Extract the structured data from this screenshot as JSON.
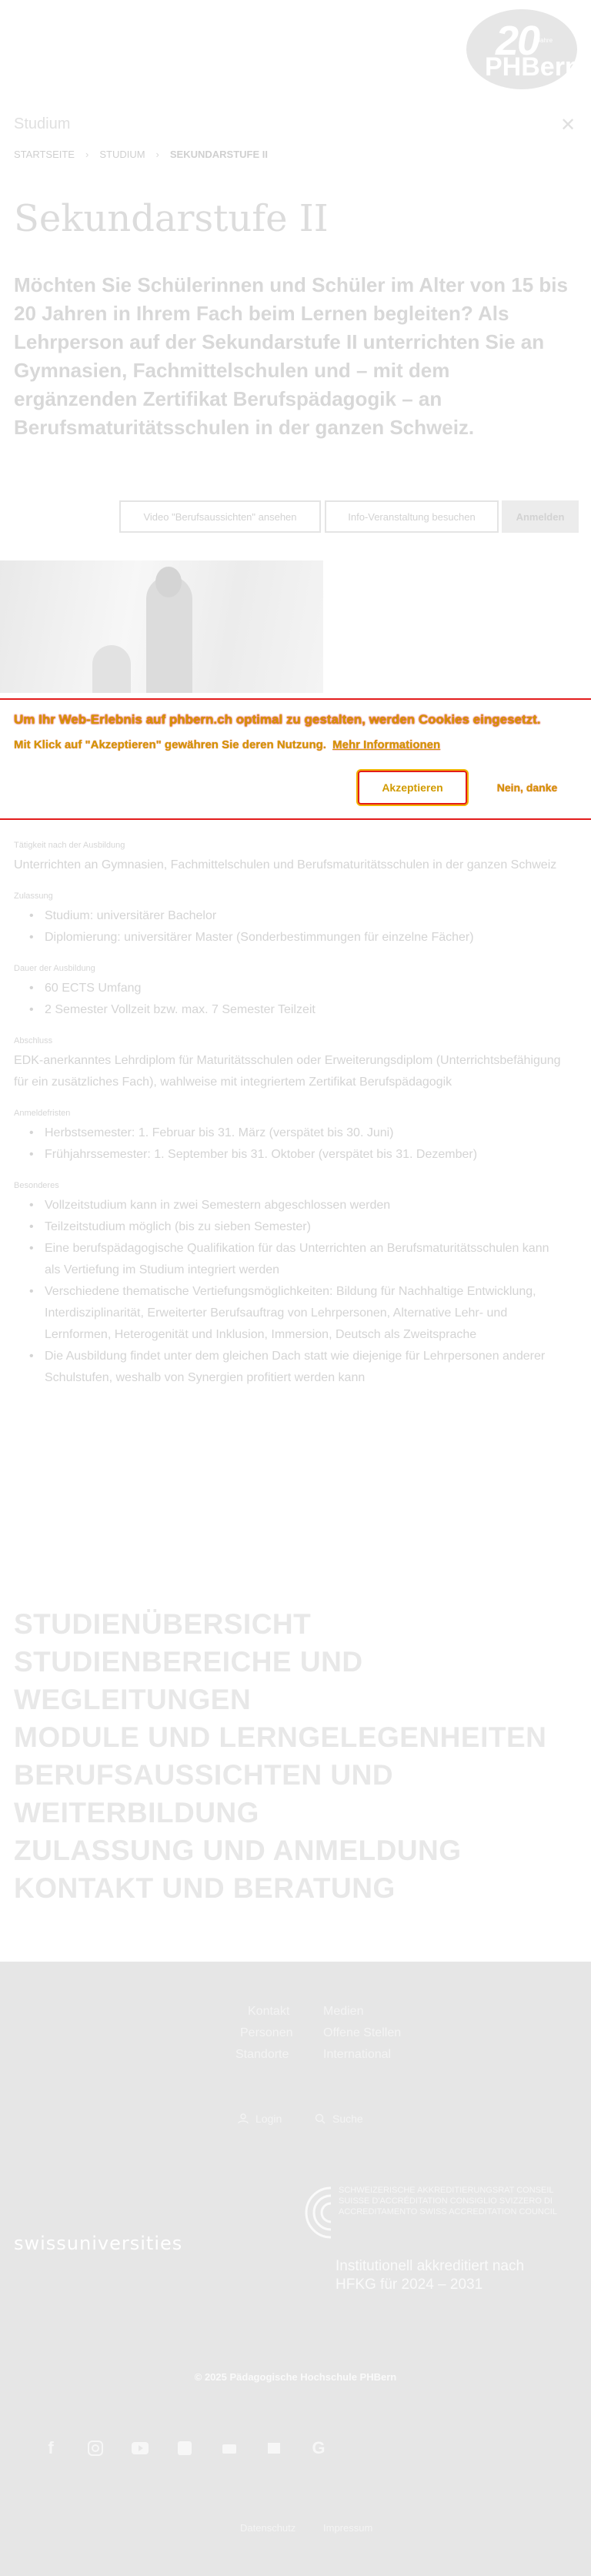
{
  "header": {
    "logo_number": "20",
    "logo_jahre": "Jahre",
    "logo_brand": "PHBern",
    "section_label": "Studium",
    "close_glyph": "✕"
  },
  "breadcrumb": {
    "items": [
      "STARTSEITE",
      "STUDIUM",
      "SEKUNDARSTUFE II"
    ],
    "separator": "›"
  },
  "page": {
    "title": "Sekundarstufe II",
    "lead": "Möchten Sie Schülerinnen und Schüler im Alter von 15 bis 20 Jahren in Ihrem Fach beim Lernen begleiten? Als Lehrperson auf der Sekundarstufe II unterrichten Sie an Gymnasien, Fachmittelschulen und – mit dem ergänzenden Zertifikat Berufspädagogik – an Berufsmaturitätsschulen in der ganzen Schweiz."
  },
  "cta": {
    "video": "Video \"Berufsaussichten\" ansehen",
    "info": "Info-Veranstaltung besuchen",
    "anmelden": "Anmelden"
  },
  "cookie": {
    "line1": "Um Ihr Web-Erlebnis auf phbern.ch optimal zu gestalten, werden Cookies eingesetzt.",
    "line2": "Mit Klick auf \"Akzeptieren\" gewähren Sie deren Nutzung.",
    "more": "Mehr Informationen",
    "accept": "Akzeptieren",
    "decline": "Nein, danke"
  },
  "facts": {
    "taetigkeit_label": "Tätigkeit nach der Ausbildung",
    "taetigkeit_text": "Unterrichten an Gymnasien, Fachmittelschulen und Berufsmaturitätsschulen in der ganzen Schweiz",
    "zulassung_label": "Zulassung",
    "zulassung_items": [
      "Studium: universitärer Bachelor",
      "Diplomierung: universitärer Master (Sonderbestimmungen für einzelne Fächer)"
    ],
    "dauer_label": "Dauer der Ausbildung",
    "dauer_items": [
      "60 ECTS Umfang",
      "2 Semester Vollzeit bzw. max. 7 Semester Teilzeit"
    ],
    "abschluss_label": "Abschluss",
    "abschluss_text": "EDK-anerkanntes Lehrdiplom für Maturitätsschulen oder Erweiterungsdiplom (Unterrichtsbefähigung für ein zusätzliches Fach), wahlweise mit integriertem Zertifikat Berufspädagogik",
    "anmeldung_label": "Anmeldefristen",
    "anmeldung_items": [
      "Herbstsemester: 1. Februar bis 31. März (verspätet bis 30. Juni)",
      "Frühjahrssemester: 1. September bis 31. Oktober (verspätet bis 31. Dezember)"
    ],
    "besonderes_label": "Besonderes",
    "besonderes_items": [
      "Vollzeitstudium kann in zwei Semestern abgeschlossen werden",
      "Teilzeitstudium möglich (bis zu sieben Semester)",
      "Eine berufspädagogische Qualifikation für das Unterrichten an Berufsmaturitätsschulen kann als Vertiefung im Studium integriert werden",
      "Verschiedene thematische Vertiefungsmöglichkeiten: Bildung für Nachhaltige Entwicklung, Interdisziplinarität, Erweiterter Berufsauftrag von Lehrpersonen, Alternative Lehr- und Lernformen, Heterogenität und Inklusion, Immersion, Deutsch als Zweitsprache",
      "Die Ausbildung findet unter dem gleichen Dach statt wie diejenige für Lehrpersonen anderer Schulstufen, weshalb von Synergien profitiert werden kann"
    ]
  },
  "bignav": [
    "STUDIENÜBERSICHT",
    "STUDIENBEREICHE UND WEGLEITUNGEN",
    "MODULE UND LERNGELEGENHEITEN",
    "BERUFSAUSSICHTEN UND WEITERBILDUNG",
    "ZULASSUNG UND ANMELDUNG",
    "KONTAKT UND BERATUNG"
  ],
  "footer": {
    "links_left": [
      "Kontakt",
      "Personen",
      "Standorte"
    ],
    "links_right": [
      "Medien",
      "Offene Stellen",
      "International"
    ],
    "login": "Login",
    "search": "Suche",
    "swissuniversities": "swissuniversities",
    "accr_small": "SCHWEIZERISCHE AKKREDITIERUNGSRAT CONSEIL SUISSE D'ACCRÉDITATION CONSIGLIO SVIZZERO DI ACCREDITAMENTO SWISS ACCREDITATION COUNCIL",
    "accr_main": "Institutionell akkreditiert nach HFKG für 2024 – 2031",
    "copyright": "© 2025 Pädagogische Hochschule PHBern",
    "social_icons": [
      "facebook-icon",
      "instagram-icon",
      "youtube-icon",
      "linkedin-icon",
      "podcast-icon",
      "blog-icon",
      "google-icon"
    ],
    "datenschutz": "Datenschutz",
    "impressum": "Impressum"
  }
}
